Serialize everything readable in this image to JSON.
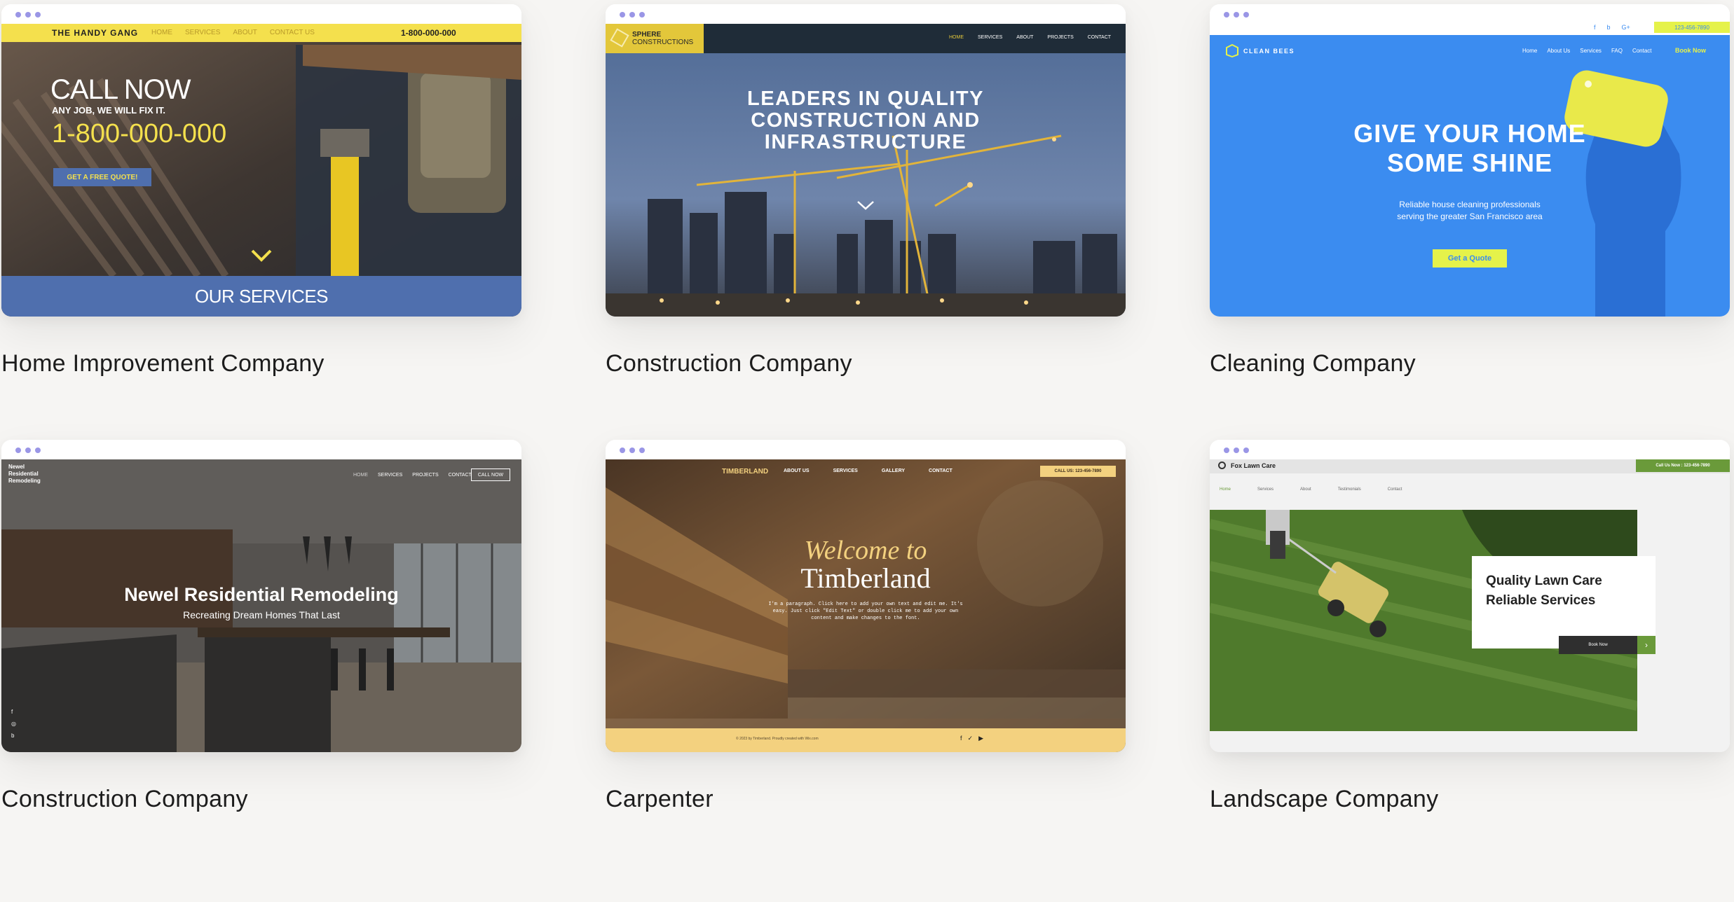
{
  "cards": [
    {
      "caption": "Home Improvement Company",
      "brand": "THE HANDY GANG",
      "nav": [
        "HOME",
        "SERVICES",
        "ABOUT",
        "CONTACT US"
      ],
      "phone": "1-800-000-000",
      "headline": "CALL NOW",
      "subline": "ANY JOB, WE WILL FIX IT.",
      "big_phone": "1-800-000-000",
      "cta": "GET A FREE QUOTE!",
      "footer_band": "OUR SERVICES",
      "colors": {
        "accent": "#f4e04d",
        "band": "#4f6fae"
      }
    },
    {
      "caption": "Construction Company",
      "brand_line1": "SPHERE",
      "brand_line2": "CONSTRUCTIONS",
      "nav": [
        "HOME",
        "SERVICES",
        "ABOUT",
        "PROJECTS",
        "CONTACT"
      ],
      "headline": [
        "LEADERS IN QUALITY",
        "CONSTRUCTION AND",
        "INFRASTRUCTURE"
      ],
      "colors": {
        "accent": "#e3c73a",
        "nav_bg": "#1f2c38"
      }
    },
    {
      "caption": "Cleaning Company",
      "phone": "123-456-7890",
      "brand": "CLEAN BEES",
      "nav": [
        "Home",
        "About Us",
        "Services",
        "FAQ",
        "Contact"
      ],
      "book": "Book Now",
      "headline": [
        "GIVE YOUR HOME",
        "SOME SHINE"
      ],
      "body": [
        "Reliable house cleaning professionals",
        "serving the greater San Francisco area"
      ],
      "cta": "Get a Quote",
      "colors": {
        "bg": "#3b8cf0",
        "accent": "#e5f24a"
      }
    },
    {
      "caption": "Construction Company",
      "brand": [
        "Newel",
        "Residential",
        "Remodeling"
      ],
      "nav": [
        "HOME",
        "SERVICES",
        "PROJECTS",
        "CONTACT"
      ],
      "cta": "CALL NOW",
      "headline": "Newel Residential Remodeling",
      "subline": "Recreating Dream Homes That Last"
    },
    {
      "caption": "Carpenter",
      "brand": "TIMBERLAND",
      "nav": [
        "ABOUT US",
        "SERVICES",
        "GALLERY",
        "CONTACT"
      ],
      "call": "CALL US: 123-456-7890",
      "welcome": "Welcome to",
      "title": "Timberland",
      "body": [
        "I'm a paragraph. Click here to add your own text and edit me. It's",
        "easy. Just click \"Edit Text\" or double click me to add your own",
        "content and make changes to the font."
      ],
      "footer": "© 2023 by Timberland. Proudly created with Wix.com",
      "colors": {
        "accent": "#f3d17f"
      }
    },
    {
      "caption": "Landscape Company",
      "brand": "Fox Lawn Care",
      "call": "Call Us Now : 123-456-7890",
      "nav": [
        "Home",
        "Services",
        "About",
        "Testimonials",
        "Contact"
      ],
      "headline": [
        "Quality Lawn Care",
        "Reliable Services"
      ],
      "cta": "Book Now",
      "colors": {
        "accent": "#6a9a3a"
      }
    }
  ]
}
